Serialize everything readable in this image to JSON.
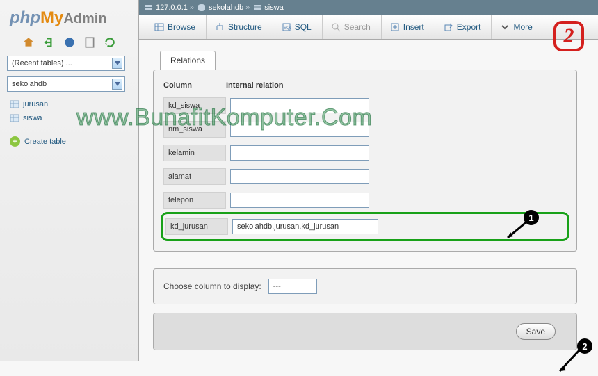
{
  "logo": {
    "part1": "php",
    "part2": "My",
    "part3": "Admin"
  },
  "sidebar": {
    "recent_tables": "(Recent tables) ...",
    "current_db": "sekolahdb",
    "tables": [
      "jurusan",
      "siswa"
    ],
    "create_table": "Create table"
  },
  "breadcrumb": {
    "server": "127.0.0.1",
    "db": "sekolahdb",
    "table": "siswa"
  },
  "tabs": {
    "browse": "Browse",
    "structure": "Structure",
    "sql": "SQL",
    "search": "Search",
    "insert": "Insert",
    "export": "Export",
    "more": "More"
  },
  "subtab": "Relations",
  "relations": {
    "head_col": "Column",
    "head_rel": "Internal relation",
    "rows": [
      {
        "col": "kd_siswa",
        "val": ""
      },
      {
        "col": "nm_siswa",
        "val": ""
      },
      {
        "col": "kelamin",
        "val": ""
      },
      {
        "col": "alamat",
        "val": ""
      },
      {
        "col": "telepon",
        "val": ""
      },
      {
        "col": "kd_jurusan",
        "val": "sekolahdb.jurusan.kd_jurusan"
      }
    ]
  },
  "display_col": {
    "label": "Choose column to display:",
    "value": "---"
  },
  "save_label": "Save",
  "annotation": {
    "box": "2",
    "circle1": "1",
    "circle2": "2"
  },
  "watermark": "www.BunafitKomputer.Com"
}
